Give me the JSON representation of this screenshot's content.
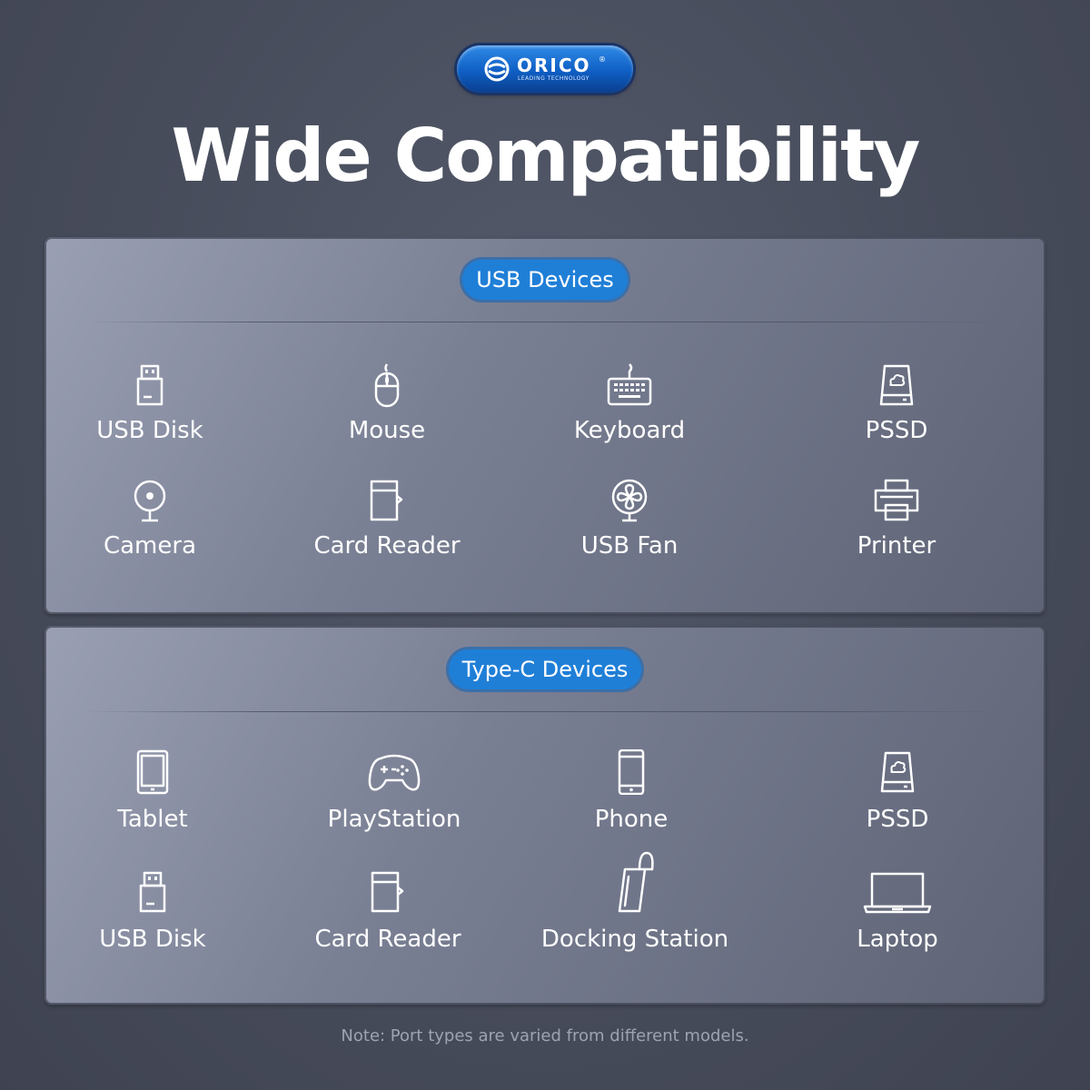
{
  "brand": {
    "name": "ORICO",
    "registered": "®",
    "tagline": "LEADING TECHNOLOGY",
    "logo_icon": "orico-swirl-logo-icon",
    "color": "#1a6fd1"
  },
  "title": "Wide Compatibility",
  "accent_color": "#1f7fd7",
  "sections": [
    {
      "heading": "USB Devices",
      "items": [
        {
          "label": "USB Disk",
          "icon": "usb-disk-icon"
        },
        {
          "label": "Mouse",
          "icon": "mouse-icon"
        },
        {
          "label": "Keyboard",
          "icon": "keyboard-icon"
        },
        {
          "label": "PSSD",
          "icon": "pssd-icon"
        },
        {
          "label": "Camera",
          "icon": "camera-icon"
        },
        {
          "label": "Card Reader",
          "icon": "card-reader-icon"
        },
        {
          "label": "USB Fan",
          "icon": "usb-fan-icon"
        },
        {
          "label": "Printer",
          "icon": "printer-icon"
        }
      ]
    },
    {
      "heading": "Type-C Devices",
      "items": [
        {
          "label": "Tablet",
          "icon": "tablet-icon"
        },
        {
          "label": "PlayStation",
          "icon": "gamepad-icon"
        },
        {
          "label": "Phone",
          "icon": "phone-icon"
        },
        {
          "label": "PSSD",
          "icon": "pssd-icon"
        },
        {
          "label": "USB Disk",
          "icon": "usb-disk-icon"
        },
        {
          "label": "Card Reader",
          "icon": "card-reader-icon"
        },
        {
          "label": "Docking Station",
          "icon": "docking-station-icon"
        },
        {
          "label": "Laptop",
          "icon": "laptop-icon"
        }
      ]
    }
  ],
  "note": "Note: Port types are varied from different models."
}
